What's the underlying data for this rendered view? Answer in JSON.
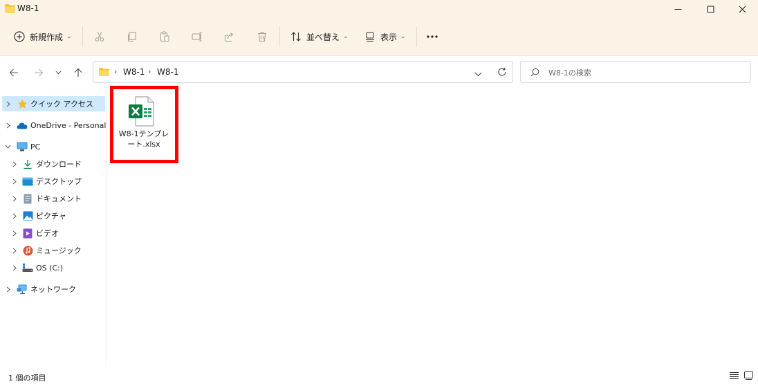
{
  "window": {
    "title": "W8-1"
  },
  "toolbar": {
    "new_label": "新規作成",
    "sort_label": "並べ替え",
    "view_label": "表示",
    "more_label": "•••"
  },
  "address": {
    "crumbs": [
      "W8-1",
      "W8-1"
    ]
  },
  "search": {
    "placeholder": "W8-1の検索"
  },
  "sidebar": {
    "quick_access": "クイック アクセス",
    "onedrive": "OneDrive - Personal",
    "pc": "PC",
    "pc_items": [
      "ダウンロード",
      "デスクトップ",
      "ドキュメント",
      "ピクチャ",
      "ビデオ",
      "ミュージック",
      "OS (C:)"
    ],
    "network": "ネットワーク"
  },
  "files": [
    {
      "name": "W8-1テンプレート.xlsx",
      "icon": "excel-file-icon"
    }
  ],
  "status": {
    "count_text": "1 個の項目"
  },
  "colors": {
    "chrome_bg": "#faf3e6",
    "highlight": "#ff0000",
    "selected": "#cde8ff",
    "excel_green": "#107c41"
  }
}
